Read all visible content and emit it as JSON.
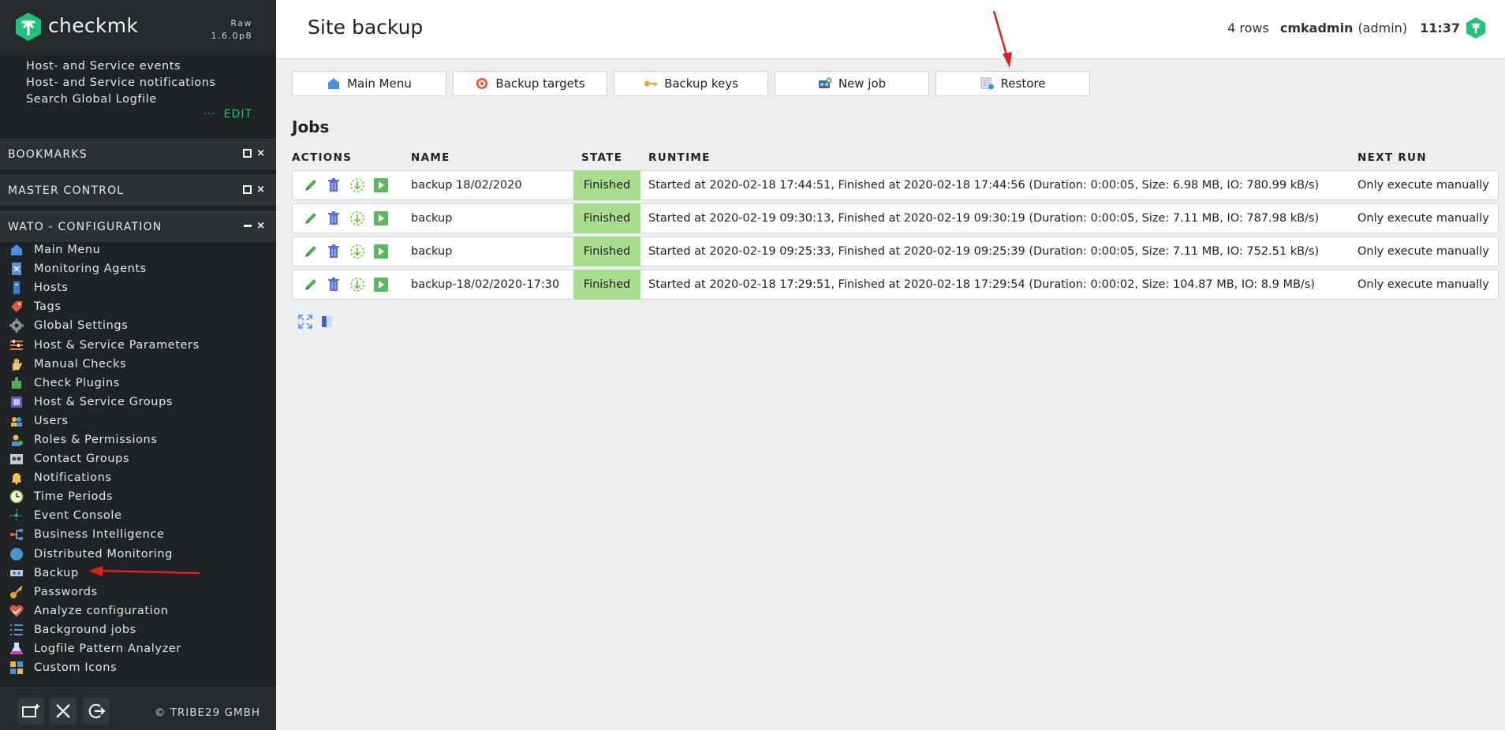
{
  "brand": {
    "name": "checkmk",
    "edition": "Raw",
    "version": "1.6.0p8"
  },
  "sidebar": {
    "events": [
      "Host- and Service events",
      "Host- and Service notifications",
      "Search Global Logfile"
    ],
    "edit_dots": "···",
    "edit_label": "EDIT",
    "snapins": [
      "BOOKMARKS",
      "MASTER CONTROL",
      "WATO - CONFIGURATION"
    ],
    "wato_items": [
      {
        "label": "Main Menu",
        "icon": "home-icon"
      },
      {
        "label": "Monitoring Agents",
        "icon": "agent-icon"
      },
      {
        "label": "Hosts",
        "icon": "host-icon"
      },
      {
        "label": "Tags",
        "icon": "tag-icon"
      },
      {
        "label": "Global Settings",
        "icon": "gear-icon"
      },
      {
        "label": "Host & Service Parameters",
        "icon": "rules-icon"
      },
      {
        "label": "Manual Checks",
        "icon": "hand-icon"
      },
      {
        "label": "Check Plugins",
        "icon": "puzzle-icon"
      },
      {
        "label": "Host & Service Groups",
        "icon": "groups-icon"
      },
      {
        "label": "Users",
        "icon": "users-icon"
      },
      {
        "label": "Roles & Permissions",
        "icon": "roles-icon"
      },
      {
        "label": "Contact Groups",
        "icon": "contact-groups-icon"
      },
      {
        "label": "Notifications",
        "icon": "bell-icon"
      },
      {
        "label": "Time Periods",
        "icon": "clock-icon"
      },
      {
        "label": "Event Console",
        "icon": "event-console-icon"
      },
      {
        "label": "Business Intelligence",
        "icon": "bi-icon"
      },
      {
        "label": "Distributed Monitoring",
        "icon": "globe-icon"
      },
      {
        "label": "Backup",
        "icon": "backup-icon"
      },
      {
        "label": "Passwords",
        "icon": "key-icon"
      },
      {
        "label": "Analyze configuration",
        "icon": "analyze-icon"
      },
      {
        "label": "Background jobs",
        "icon": "list-icon"
      },
      {
        "label": "Logfile Pattern Analyzer",
        "icon": "flask-icon"
      },
      {
        "label": "Custom Icons",
        "icon": "custom-icons-icon"
      }
    ],
    "copyright": "© TRIBE29 GMBH"
  },
  "header": {
    "title": "Site backup",
    "rows": "4 rows",
    "user": "cmkadmin",
    "role": "(admin)",
    "time": "11:37"
  },
  "toolbar": [
    {
      "label": "Main Menu",
      "icon": "home-icon"
    },
    {
      "label": "Backup targets",
      "icon": "target-icon"
    },
    {
      "label": "Backup keys",
      "icon": "key-icon"
    },
    {
      "label": "New job",
      "icon": "new-job-icon"
    },
    {
      "label": "Restore",
      "icon": "restore-icon"
    }
  ],
  "jobs": {
    "title": "Jobs",
    "columns": [
      "ACTIONS",
      "NAME",
      "STATE",
      "RUNTIME",
      "NEXT RUN"
    ],
    "rows": [
      {
        "name": "backup 18/02/2020",
        "state": "Finished",
        "runtime": "Started at 2020-02-18 17:44:51, Finished at 2020-02-18 17:44:56 (Duration: 0:00:05, Size: 6.98 MB, IO: 780.99 kB/s)",
        "next_run": "Only execute manually"
      },
      {
        "name": "backup",
        "state": "Finished",
        "runtime": "Started at 2020-02-19 09:30:13, Finished at 2020-02-19 09:30:19 (Duration: 0:00:05, Size: 7.11 MB, IO: 787.98 kB/s)",
        "next_run": "Only execute manually"
      },
      {
        "name": "backup",
        "state": "Finished",
        "runtime": "Started at 2020-02-19 09:25:33, Finished at 2020-02-19 09:25:39 (Duration: 0:00:05, Size: 7.11 MB, IO: 752.51 kB/s)",
        "next_run": "Only execute manually"
      },
      {
        "name": "backup-18/02/2020-17:30",
        "state": "Finished",
        "runtime": "Started at 2020-02-18 17:29:51, Finished at 2020-02-18 17:29:54 (Duration: 0:00:02, Size: 104.87 MB, IO: 8.9 MB/s)",
        "next_run": "Only execute manually"
      }
    ]
  },
  "colors": {
    "accent": "#1ec27b",
    "sidebar_bg": "#1f2325",
    "state_ok": "#a9de8f",
    "annotation": "#e02020"
  }
}
